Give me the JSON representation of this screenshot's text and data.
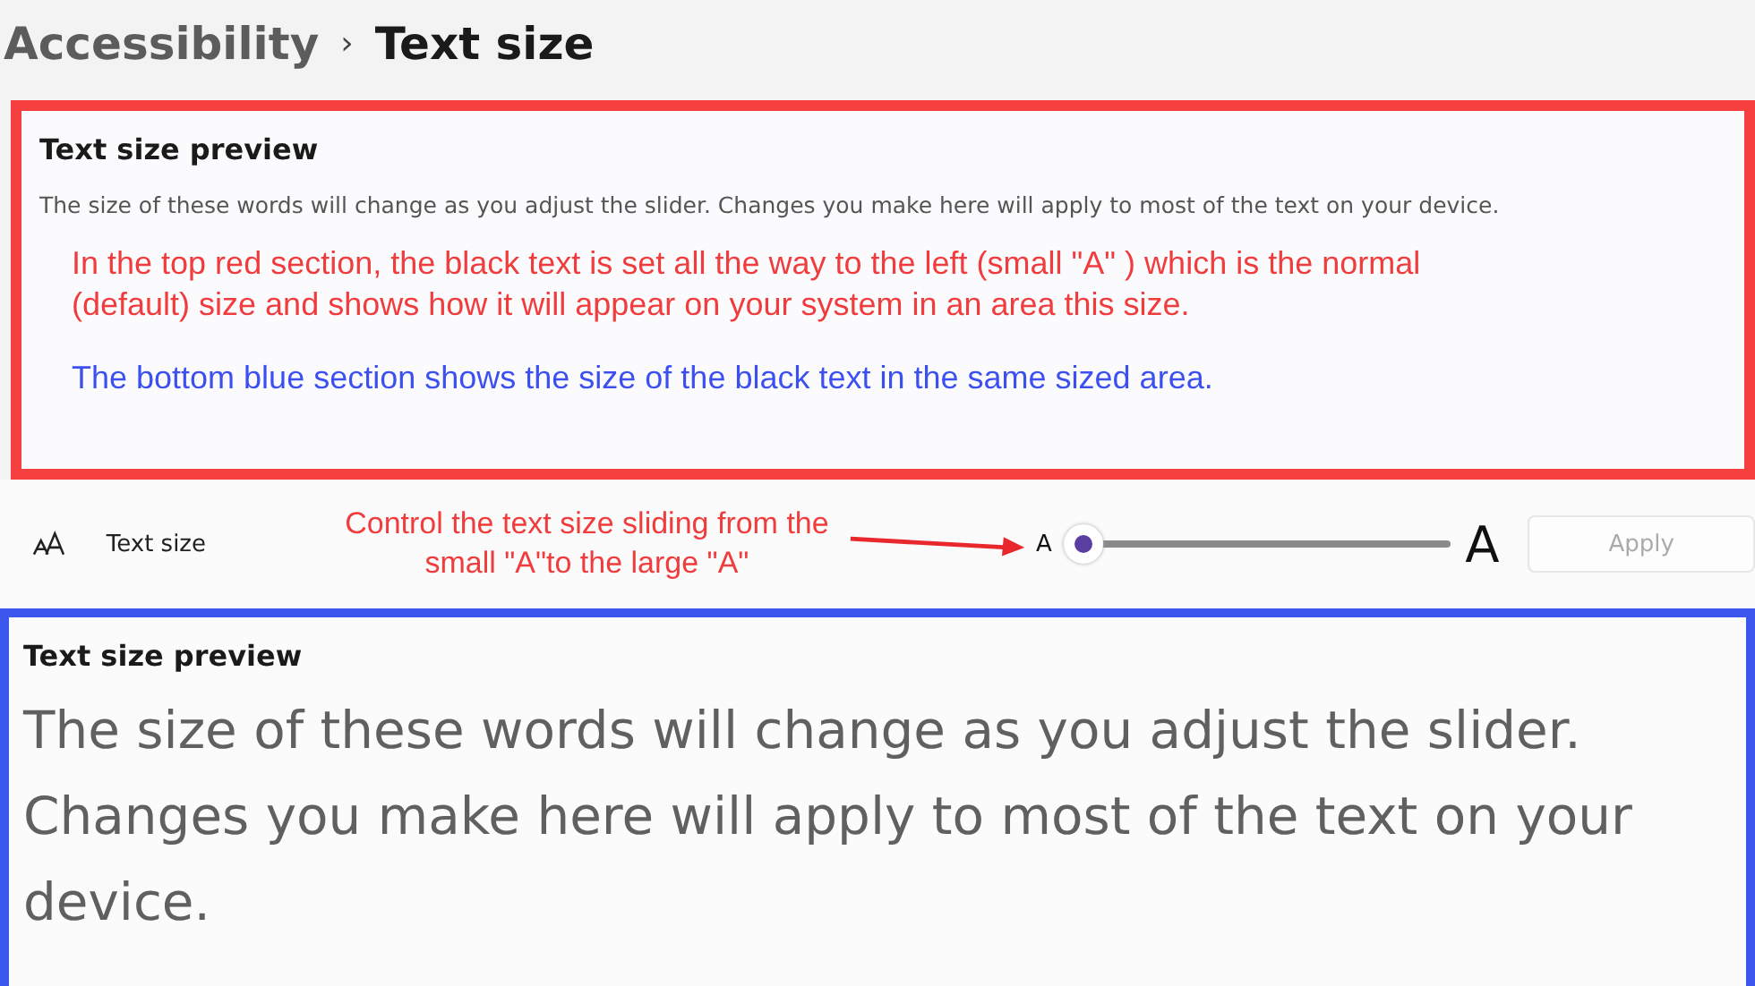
{
  "breadcrumb": {
    "parent": "Accessibility",
    "separator": "›",
    "current": "Text size"
  },
  "top_preview": {
    "title": "Text size preview",
    "description": "The size of these words will change as you adjust the slider. Changes you make here will apply to most of the text on your device.",
    "annotations": [
      {
        "text": "In the top red section, the black text is set all the way to the left (small \"A\" ) which is the normal (default) size and shows how it will appear on your system in an area this size.",
        "color": "#f03c3c"
      },
      {
        "text": "The bottom blue section shows the size of the black text in the same sized area.",
        "color": "#3c50f0"
      }
    ]
  },
  "text_size_row": {
    "label": "Text size",
    "annotation": "Control the text size sliding from the small \"A\"to the large \"A\"",
    "small_label": "A",
    "large_label": "A",
    "slider": {
      "level": 0
    },
    "apply_button": {
      "label": "Apply",
      "disabled": true
    }
  },
  "bottom_preview": {
    "title": "Text size preview",
    "description": "The size of these words will change as you adjust the slider. Changes you make here will apply to most of the text on your device."
  }
}
